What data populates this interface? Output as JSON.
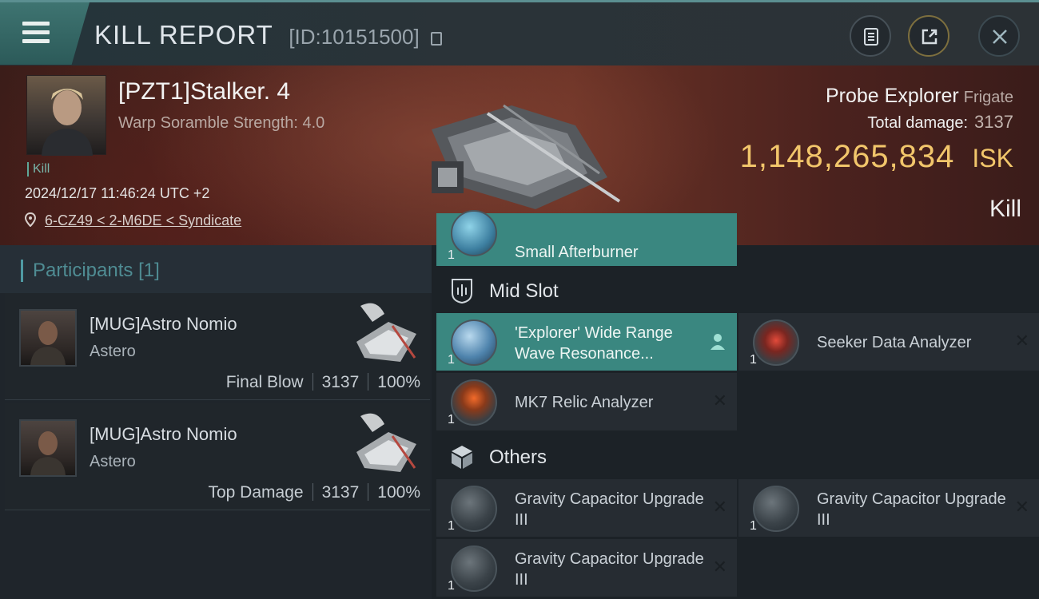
{
  "header": {
    "title": "KILL REPORT",
    "report_id": "[ID:10151500]"
  },
  "victim": {
    "pilot_name": "[PZT1]Stalker. 4",
    "warp_scramble": "Warp Soramble Strength: 4.0",
    "kill_tag": "Kill",
    "datetime": "2024/12/17 11:46:24 UTC +2",
    "location": "6-CZ49 < 2-M6DE < Syndicate",
    "ship_name": "Probe Explorer",
    "ship_class": "Frigate",
    "total_damage_label": "Total damage:",
    "total_damage": "3137",
    "isk_value": "1,148,265,834",
    "isk_unit": "ISK",
    "result": "Kill"
  },
  "participants": {
    "title": "Participants",
    "count": "[1]",
    "items": [
      {
        "name": "[MUG]Astro Nomio",
        "ship": "Astero",
        "role": "Final Blow",
        "damage": "3137",
        "percent": "100%"
      },
      {
        "name": "[MUG]Astro Nomio",
        "ship": "Astero",
        "role": "Top Damage",
        "damage": "3137",
        "percent": "100%"
      }
    ]
  },
  "fittings": {
    "low_partial": {
      "name": "Small Afterburner",
      "qty": "1"
    },
    "mid_slot": {
      "title": "Mid Slot",
      "items": [
        {
          "name": "'Explorer' Wide Range Wave Resonance...",
          "qty": "1"
        },
        {
          "name": "Seeker Data Analyzer",
          "qty": "1"
        },
        {
          "name": "MK7 Relic Analyzer",
          "qty": "1"
        }
      ]
    },
    "others": {
      "title": "Others",
      "items": [
        {
          "name": "Gravity Capacitor Upgrade III",
          "qty": "1"
        },
        {
          "name": "Gravity Capacitor Upgrade III",
          "qty": "1"
        },
        {
          "name": "Gravity Capacitor Upgrade III",
          "qty": "1"
        }
      ]
    }
  },
  "icons": {
    "menu": "hamburger-icon",
    "copy": "copy-icon",
    "clipboard": "clipboard-icon",
    "share": "share-icon",
    "close": "close-icon",
    "location": "location-pin-icon",
    "mid_slot": "mid-slot-icon",
    "others": "cube-icon",
    "remove": "x-icon",
    "person": "person-icon"
  },
  "colors": {
    "accent": "#3a8780",
    "isk": "#f2c66b",
    "banner": "#5a2a23"
  }
}
